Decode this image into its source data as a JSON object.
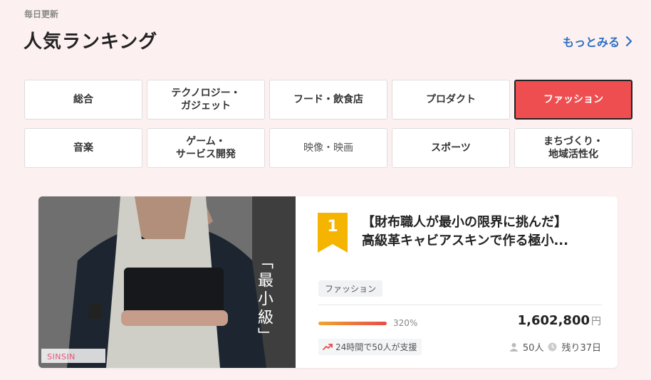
{
  "header": {
    "update_label": "毎日更新",
    "title": "人気ランキング",
    "see_more": "もっとみる"
  },
  "categories": [
    {
      "label": "総合"
    },
    {
      "label": "テクノロジー・\nガジェット"
    },
    {
      "label": "フード・飲食店"
    },
    {
      "label": "プロダクト"
    },
    {
      "label": "ファッション",
      "active": true
    },
    {
      "label": "音楽"
    },
    {
      "label": "ゲーム・\nサービス開発"
    },
    {
      "label": "映像・映画"
    },
    {
      "label": "スポーツ"
    },
    {
      "label": "まちづくり・\n地域活性化"
    }
  ],
  "project": {
    "rank": "1",
    "title_line1": "【財布職人が最小の限界に挑んだ】",
    "title_line2": "高級革キャビアスキンで作る極小...",
    "image_overlay_text": "「最小級」",
    "brand_logo": "SINSIN",
    "tag": "ファッション",
    "progress_fraction": 1.0,
    "percent": "320%",
    "amount": "1,602,800",
    "currency": "円",
    "trend": "24時間で50人が支援",
    "backers": "50人",
    "remaining": "残り37日"
  },
  "colors": {
    "accent": "#ee4e50",
    "link": "#2d6fc4",
    "badge": "#f5b400",
    "background": "#fcf1f0"
  },
  "icons": {
    "see_more": "chevron-right-icon",
    "rank": "ribbon-badge-icon",
    "trend": "trending-up-icon",
    "backers": "person-icon",
    "remaining": "clock-icon"
  }
}
